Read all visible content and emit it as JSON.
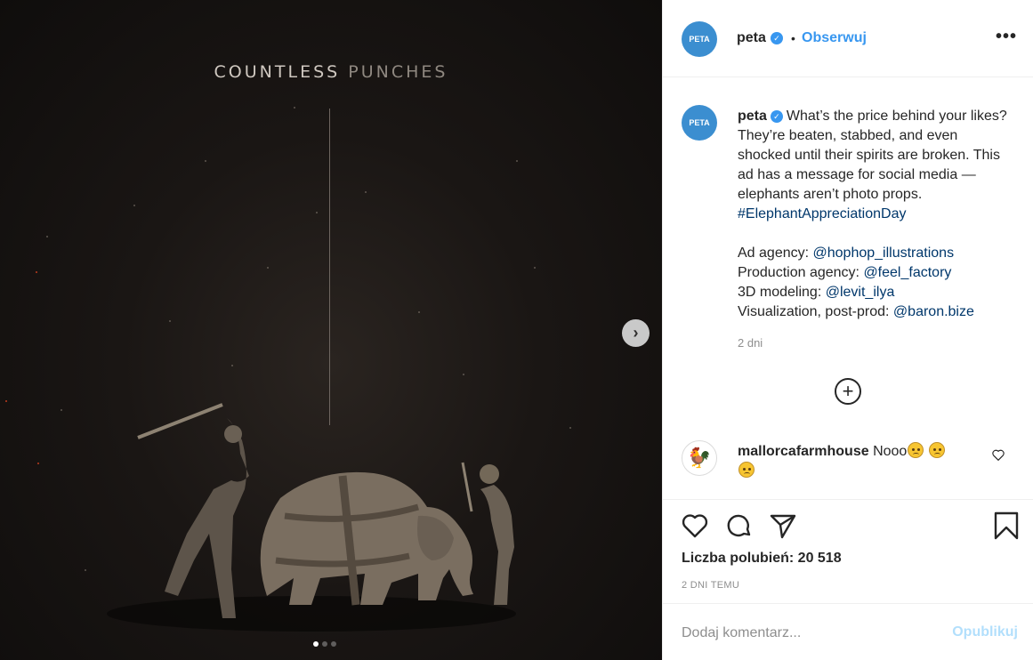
{
  "media": {
    "title_word1": "COUNTLESS",
    "title_word2": "PUNCHES",
    "slides_total": 3,
    "slide_active": 1,
    "next_icon": "chevron-right-icon"
  },
  "header": {
    "avatar_text": "PETA",
    "username": "peta",
    "verified_icon": "verified-badge-icon",
    "bullet": "•",
    "follow_label": "Obserwuj",
    "more_icon": "more-options-icon"
  },
  "caption": {
    "username": "peta",
    "text1": "What’s the price behind your likes? They’re beaten, stabbed, and even shocked until their spirits are broken. This ad has a message for social media — elephants aren’t photo props.",
    "hashtag": "#ElephantAppreciationDay",
    "credits": [
      {
        "label": "Ad agency:",
        "handle": "@hophop_illustrations"
      },
      {
        "label": "Production agency:",
        "handle": "@feel_factory"
      },
      {
        "label": "3D modeling:",
        "handle": "@levit_ilya"
      },
      {
        "label": "Visualization, post-prod:",
        "handle": "@baron.bize"
      }
    ],
    "time_ago": "2 dni",
    "load_more_icon": "plus-circle-icon"
  },
  "comment": {
    "username": "mallorcafarmhouse",
    "text": "Nooo",
    "emoji": "worried-face-emoji",
    "like_icon": "heart-outline-icon"
  },
  "actions": {
    "like_icon": "heart-icon",
    "comment_icon": "comment-icon",
    "share_icon": "send-icon",
    "save_icon": "bookmark-icon",
    "likes_text": "Liczba polubień: 20 518",
    "date_text": "2 DNI TEMU",
    "add_comment_placeholder": "Dodaj komentarz...",
    "publish_label": "Opublikuj"
  },
  "colors": {
    "accent": "#3897f0",
    "link": "#00376b",
    "publish_disabled": "#b2dffc"
  }
}
